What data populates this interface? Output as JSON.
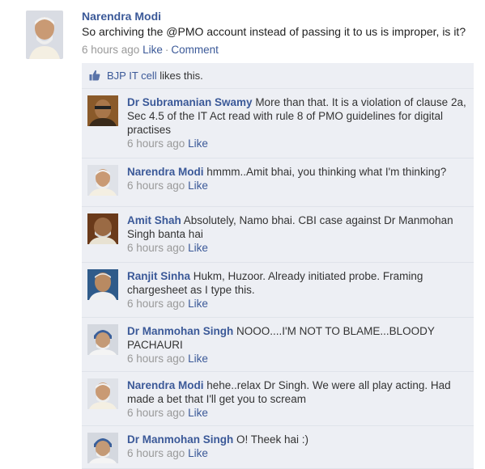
{
  "post": {
    "author": "Narendra Modi",
    "text": "So archiving the @PMO account instead of passing it to us is improper, is it?",
    "time": "6 hours ago",
    "like_label": "Like",
    "separator": "·",
    "comment_label": "Comment"
  },
  "likes": {
    "name": "BJP IT cell",
    "suffix": " likes this."
  },
  "comments": [
    {
      "name": "Dr Subramanian Swamy",
      "text": " More than that. It is a violation of clause 2a, Sec 4.5 of the IT Act read with rule 8 of PMO guidelines for digital practises",
      "time": "6 hours ago",
      "like": "Like"
    },
    {
      "name": "Narendra Modi",
      "text": " hmmm..Amit bhai, you thinking what I'm thinking?",
      "time": "6 hours ago",
      "like": "Like"
    },
    {
      "name": "Amit Shah",
      "text": " Absolutely, Namo bhai. CBI case against Dr Manmohan Singh banta hai",
      "time": "6 hours ago",
      "like": "Like"
    },
    {
      "name": "Ranjit Sinha",
      "text": " Hukm, Huzoor. Already initiated probe. Framing chargesheet as I type this.",
      "time": "6 hours ago",
      "like": "Like"
    },
    {
      "name": "Dr Manmohan Singh",
      "text": " NOOO....I'M NOT TO BLAME...BLOODY PACHAURI",
      "time": "6 hours ago",
      "like": "Like"
    },
    {
      "name": "Narendra Modi",
      "text": " hehe..relax Dr Singh. We were all play acting. Had made a bet that I'll get you to scream",
      "time": "6 hours ago",
      "like": "Like"
    },
    {
      "name": "Dr Manmohan Singh",
      "text": " O! Theek hai :)",
      "time": "6 hours ago",
      "like": "Like"
    }
  ]
}
